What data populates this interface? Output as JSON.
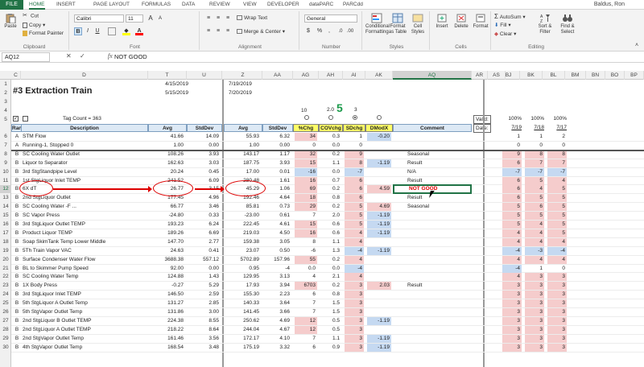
{
  "tabs": {
    "file": "FILE",
    "items": [
      "HOME",
      "INSERT",
      "PAGE LAYOUT",
      "FORMULAS",
      "DATA",
      "REVIEW",
      "VIEW",
      "DEVELOPER",
      "dataPARC",
      "PARCdd"
    ],
    "user": "Baldus, Ron"
  },
  "ribbon": {
    "clipboard": {
      "paste": "Paste",
      "cut": "Cut",
      "copy": "Copy",
      "format_painter": "Format Painter",
      "label": "Clipboard"
    },
    "font": {
      "name": "Calibri",
      "size": "11",
      "grow": "A",
      "shrink": "A",
      "bold": "B",
      "italic": "I",
      "underline": "U",
      "font_color": "A",
      "label": "Font"
    },
    "alignment": {
      "wrap": "Wrap Text",
      "merge": "Merge & Center",
      "label": "Alignment"
    },
    "number": {
      "format": "General",
      "currency": "$",
      "percent": "%",
      "comma": ",",
      "label": "Number"
    },
    "styles": {
      "cond": "Conditional Formatting",
      "table": "Format as Table",
      "cell": "Cell Styles",
      "label": "Styles"
    },
    "cells": {
      "insert": "Insert",
      "delete": "Delete",
      "format": "Format",
      "label": "Cells"
    },
    "editing": {
      "autosum": "AutoSum",
      "fill": "Fill",
      "clear": "Clear",
      "sort": "Sort & Filter",
      "find": "Find & Select",
      "label": "Editing"
    }
  },
  "formula_bar": {
    "name_box": "AQ12",
    "cancel": "✕",
    "enter": "✓",
    "fx": "fx",
    "formula": "NOT GOOD"
  },
  "columns": [
    "C",
    "D",
    "T",
    "U",
    "Z",
    "AA",
    "AG",
    "AH",
    "AI",
    "AK",
    "AQ",
    "AR",
    "AS",
    "BJ",
    "BK",
    "BL",
    "BM",
    "BN",
    "BO",
    "BP"
  ],
  "header": {
    "title": "#3 Extraction Train",
    "date1": "4/15/2019",
    "date2": "5/15/2019",
    "date3": "7/19/2019",
    "date4": "7/20/2019",
    "tag_count": "Tag Count = 363",
    "thresholds": [
      "10",
      "2.0",
      "5",
      "3"
    ],
    "col_labels": [
      "Rank",
      "Description",
      "Avg",
      "StdDev",
      "Avg",
      "StdDev",
      "%Chg",
      "COVchg",
      "SDchg",
      "DModX",
      "Comment"
    ],
    "valid": "Valid:",
    "date_label": "Date:",
    "right_pct": [
      "100%",
      "100%",
      "100%"
    ],
    "right_dates": [
      "7/19",
      "7/18",
      "7/17"
    ]
  },
  "rows": [
    {
      "n": "6",
      "rank": "A",
      "desc": "STM Flow",
      "avg1": "41.66",
      "sd1": "14.09",
      "avg2": "55.93",
      "sd2": "6.32",
      "chg": "34",
      "cov": "0.3",
      "sdc": "1",
      "dmod": "-0.20",
      "comment": "",
      "b1": "1",
      "b2": "1",
      "b3": "2"
    },
    {
      "n": "7",
      "rank": "A",
      "desc": "Running-1, Stopped 0",
      "avg1": "1.00",
      "sd1": "0.00",
      "avg2": "1.00",
      "sd2": "0.00",
      "chg": "0",
      "cov": "0.0",
      "sdc": "0",
      "dmod": "",
      "comment": "",
      "b1": "0",
      "b2": "0",
      "b3": "0"
    },
    {
      "n": "8",
      "rank": "B",
      "desc": "SC Cooling Water Outlet",
      "avg1": "108.26",
      "sd1": "3.93",
      "avg2": "143.17",
      "sd2": "1.17",
      "chg": "32",
      "cov": "0.2",
      "sdc": "9",
      "dmod": "",
      "comment": "Seasonal",
      "b1": "9",
      "b2": "8",
      "b3": "8"
    },
    {
      "n": "9",
      "rank": "B",
      "desc": "Liquor to Separator",
      "avg1": "162.63",
      "sd1": "3.03",
      "avg2": "187.75",
      "sd2": "3.93",
      "chg": "15",
      "cov": "1.1",
      "sdc": "8",
      "dmod": "-1.19",
      "comment": "Result",
      "b1": "6",
      "b2": "7",
      "b3": "7"
    },
    {
      "n": "10",
      "rank": "B",
      "desc": "3rd StgStandpipe Level",
      "avg1": "20.24",
      "sd1": "0.45",
      "avg2": "17.00",
      "sd2": "0.01",
      "chg": "-16",
      "cov": "0.0",
      "sdc": "-7",
      "dmod": "",
      "comment": "N/A",
      "b1": "-7",
      "b2": "-7",
      "b3": "-7"
    },
    {
      "n": "11",
      "rank": "B",
      "desc": "1st StgLiquor Inlet TEMP",
      "avg1": "241.52",
      "sd1": "6.09",
      "avg2": "280.48",
      "sd2": "1.61",
      "chg": "16",
      "cov": "0.7",
      "sdc": "6",
      "dmod": "",
      "comment": "Result",
      "b1": "6",
      "b2": "5",
      "b3": "4"
    },
    {
      "n": "12",
      "rank": "B",
      "desc": "6X dT",
      "avg1": "26.77",
      "sd1": "3.15",
      "avg2": "45.29",
      "sd2": "1.06",
      "chg": "69",
      "cov": "0.2",
      "sdc": "6",
      "dmod": "4.59",
      "comment": "NOT GOOD",
      "b1": "6",
      "b2": "4",
      "b3": "5"
    },
    {
      "n": "13",
      "rank": "B",
      "desc": "2nd StgLiquor Outlet",
      "avg1": "177.45",
      "sd1": "4.96",
      "avg2": "192.46",
      "sd2": "4.64",
      "chg": "18",
      "cov": "0.8",
      "sdc": "6",
      "dmod": "",
      "comment": "Result",
      "b1": "6",
      "b2": "5",
      "b3": "5"
    },
    {
      "n": "14",
      "rank": "B",
      "desc": "SC Cooling Water -F ...",
      "avg1": "66.77",
      "sd1": "3.46",
      "avg2": "85.81",
      "sd2": "0.73",
      "chg": "29",
      "cov": "0.2",
      "sdc": "5",
      "dmod": "4.69",
      "comment": "Seasonal",
      "b1": "5",
      "b2": "6",
      "b3": "5"
    },
    {
      "n": "15",
      "rank": "B",
      "desc": "SC Vapor Press",
      "avg1": "-24.80",
      "sd1": "0.33",
      "avg2": "-23.00",
      "sd2": "0.61",
      "chg": "7",
      "cov": "2.0",
      "sdc": "5",
      "dmod": "-1.19",
      "comment": "",
      "b1": "5",
      "b2": "5",
      "b3": "5"
    },
    {
      "n": "16",
      "rank": "B",
      "desc": "3rd StgLiquor Outlet TEMP",
      "avg1": "193.23",
      "sd1": "6.24",
      "avg2": "222.45",
      "sd2": "4.61",
      "chg": "15",
      "cov": "0.6",
      "sdc": "5",
      "dmod": "-1.19",
      "comment": "",
      "b1": "5",
      "b2": "4",
      "b3": "5"
    },
    {
      "n": "17",
      "rank": "B",
      "desc": "Product Liquor TEMP",
      "avg1": "189.26",
      "sd1": "6.69",
      "avg2": "219.03",
      "sd2": "4.50",
      "chg": "16",
      "cov": "0.6",
      "sdc": "4",
      "dmod": "-1.19",
      "comment": "",
      "b1": "4",
      "b2": "4",
      "b3": "5"
    },
    {
      "n": "18",
      "rank": "B",
      "desc": "Soap SkimTank Temp Lower Middle",
      "avg1": "147.70",
      "sd1": "2.77",
      "avg2": "159.38",
      "sd2": "3.05",
      "chg": "8",
      "cov": "1.1",
      "sdc": "4",
      "dmod": "",
      "comment": "",
      "b1": "4",
      "b2": "4",
      "b3": "4"
    },
    {
      "n": "19",
      "rank": "B",
      "desc": "5Th Train Vapor VAC",
      "avg1": "24.63",
      "sd1": "0.41",
      "avg2": "23.07",
      "sd2": "0.50",
      "chg": "-6",
      "cov": "1.3",
      "sdc": "-4",
      "dmod": "-1.19",
      "comment": "",
      "b1": "-4",
      "b2": "-3",
      "b3": "-4"
    },
    {
      "n": "20",
      "rank": "B",
      "desc": "Surface Condenser Water Flow",
      "avg1": "3688.38",
      "sd1": "557.12",
      "avg2": "5702.89",
      "sd2": "157.96",
      "chg": "55",
      "cov": "0.2",
      "sdc": "4",
      "dmod": "",
      "comment": "",
      "b1": "4",
      "b2": "4",
      "b3": "4"
    },
    {
      "n": "21",
      "rank": "B",
      "desc": "BL to Skimmer Pump Speed",
      "avg1": "92.00",
      "sd1": "0.00",
      "avg2": "0.95",
      "sd2": "-4",
      "chg": "0.0",
      "cov": "0.0",
      "sdc": "-4",
      "dmod": "",
      "comment": "",
      "b1": "-4",
      "b2": "1",
      "b3": "0"
    },
    {
      "n": "22",
      "rank": "B",
      "desc": "SC Cooling Water Temp",
      "avg1": "124.88",
      "sd1": "1.43",
      "avg2": "129.95",
      "sd2": "3.13",
      "chg": "4",
      "cov": "2.1",
      "sdc": "4",
      "dmod": "",
      "comment": "",
      "b1": "4",
      "b2": "3",
      "b3": "3"
    },
    {
      "n": "23",
      "rank": "B",
      "desc": "1X Body Press",
      "avg1": "-0.27",
      "sd1": "5.29",
      "avg2": "17.93",
      "sd2": "3.94",
      "chg": "6703",
      "cov": "0.2",
      "sdc": "3",
      "dmod": "2.03",
      "comment": "Result",
      "b1": "3",
      "b2": "3",
      "b3": "3"
    },
    {
      "n": "24",
      "rank": "B",
      "desc": "3rd StgLiquor Inlet TEMP",
      "avg1": "146.50",
      "sd1": "2.59",
      "avg2": "155.30",
      "sd2": "2.23",
      "chg": "6",
      "cov": "0.8",
      "sdc": "3",
      "dmod": "",
      "comment": "",
      "b1": "3",
      "b2": "3",
      "b3": "3"
    },
    {
      "n": "25",
      "rank": "B",
      "desc": "5th StgLiquor A Outlet Temp",
      "avg1": "131.27",
      "sd1": "2.85",
      "avg2": "140.33",
      "sd2": "3.64",
      "chg": "7",
      "cov": "1.5",
      "sdc": "3",
      "dmod": "",
      "comment": "",
      "b1": "3",
      "b2": "3",
      "b3": "3"
    },
    {
      "n": "26",
      "rank": "B",
      "desc": "5th StgVapor Outlet Temp",
      "avg1": "131.86",
      "sd1": "3.00",
      "avg2": "141.45",
      "sd2": "3.66",
      "chg": "7",
      "cov": "1.5",
      "sdc": "3",
      "dmod": "",
      "comment": "",
      "b1": "3",
      "b2": "3",
      "b3": "3"
    },
    {
      "n": "27",
      "rank": "B",
      "desc": "2nd StgLiquor B Outlet TEMP",
      "avg1": "224.38",
      "sd1": "8.55",
      "avg2": "250.62",
      "sd2": "4.69",
      "chg": "12",
      "cov": "0.5",
      "sdc": "3",
      "dmod": "-1.19",
      "comment": "",
      "b1": "3",
      "b2": "3",
      "b3": "3"
    },
    {
      "n": "28",
      "rank": "B",
      "desc": "2nd StgLiquor A Outlet TEMP",
      "avg1": "218.22",
      "sd1": "8.64",
      "avg2": "244.04",
      "sd2": "4.67",
      "chg": "12",
      "cov": "0.5",
      "sdc": "3",
      "dmod": "",
      "comment": "",
      "b1": "3",
      "b2": "3",
      "b3": "3"
    },
    {
      "n": "29",
      "rank": "B",
      "desc": "2nd StgVapor Outlet Temp",
      "avg1": "161.46",
      "sd1": "3.56",
      "avg2": "172.17",
      "sd2": "4.10",
      "chg": "7",
      "cov": "1.1",
      "sdc": "3",
      "dmod": "-1.19",
      "comment": "",
      "b1": "3",
      "b2": "3",
      "b3": "3"
    },
    {
      "n": "30",
      "rank": "B",
      "desc": "4th StgVapor Outlet Temp",
      "avg1": "168.54",
      "sd1": "3.48",
      "avg2": "175.19",
      "sd2": "3.32",
      "chg": "6",
      "cov": "0.9",
      "sdc": "3",
      "dmod": "-1.19",
      "comment": "",
      "b1": "3",
      "b2": "3",
      "b3": "3"
    }
  ]
}
